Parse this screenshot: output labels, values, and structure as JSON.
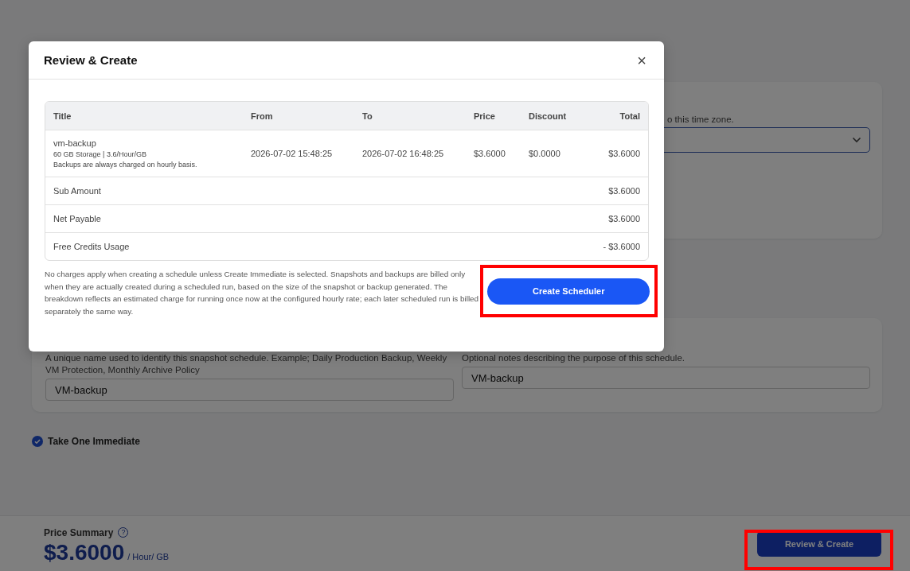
{
  "page": {
    "timezone_hint": "o this time zone.",
    "name_field": {
      "hint": "A unique name used to identify this snapshot schedule. Example; Daily Production Backup, Weekly VM Protection, Monthly Archive Policy",
      "value": "VM-backup"
    },
    "notes_field": {
      "hint": "Optional notes describing the purpose of this schedule.",
      "value": "VM-backup"
    },
    "take_immediate": {
      "label": "Take One Immediate",
      "checked": true
    }
  },
  "footer": {
    "label": "Price Summary",
    "help": "?",
    "price": "$3.6000",
    "unit": "/ Hour/ GB",
    "button": "Review & Create",
    "highlighted": true
  },
  "modal": {
    "title": "Review & Create",
    "close": "×",
    "table": {
      "columns": [
        "Title",
        "From",
        "To",
        "Price",
        "Discount",
        "Total"
      ],
      "rows": [
        {
          "title": "vm-backup",
          "details": [
            "60 GB Storage | 3.6/Hour/GB",
            "Backups are always charged on hourly basis."
          ],
          "from": "2026-07-02 15:48:25",
          "to": "2026-07-02 16:48:25",
          "price": "$3.6000",
          "discount": "$0.0000",
          "total": "$3.6000"
        }
      ],
      "summary": [
        {
          "label": "Sub Amount",
          "value": "$3.6000"
        },
        {
          "label": "Net Payable",
          "value": "$3.6000"
        },
        {
          "label": "Free Credits Usage",
          "value": "- $3.6000"
        }
      ]
    },
    "note": "No charges apply when creating a schedule unless Create Immediate is selected. Snapshots and backups are billed only when they are actually created during a scheduled run, based on the size of the snapshot or backup generated. The breakdown reflects an estimated charge for running once now at the configured hourly rate; each later scheduled run is billed separately the same way.",
    "button": "Create Scheduler",
    "highlighted": true
  }
}
